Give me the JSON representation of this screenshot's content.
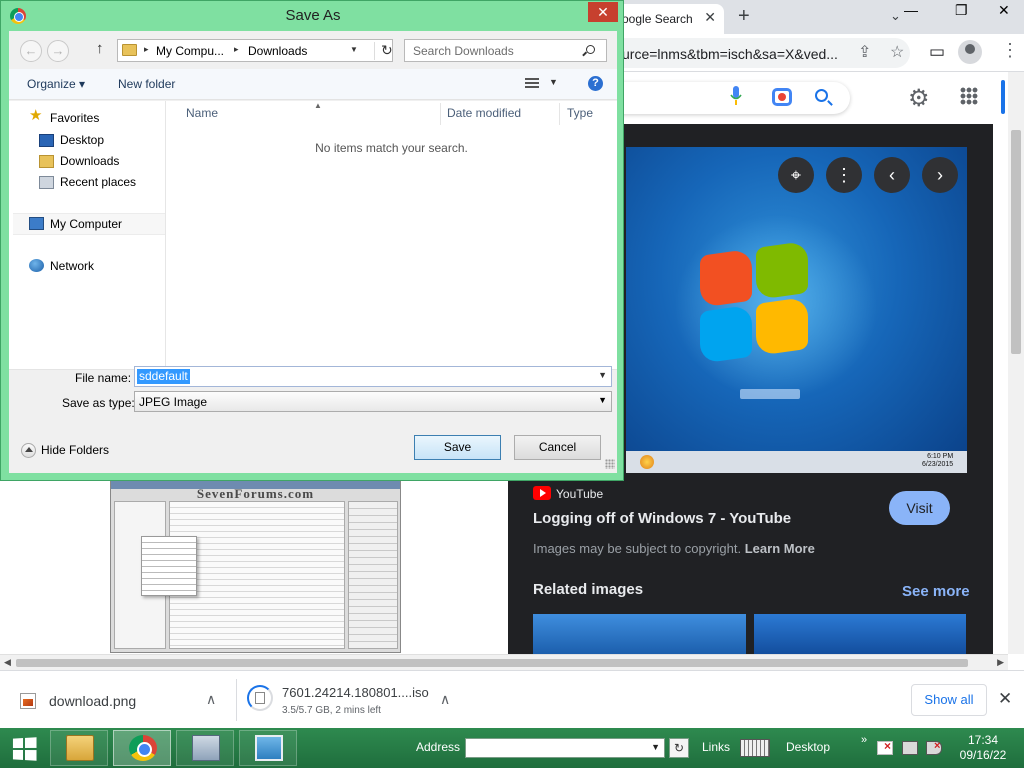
{
  "browser": {
    "tab": {
      "title": "oogle Search",
      "close": "✕"
    },
    "new_tab": "+",
    "tab_dropdown": "⌄",
    "window_controls": {
      "minimize": "—",
      "restore": "❐",
      "close": "✕"
    },
    "url": "urce=lnms&tbm=isch&sa=X&ved...",
    "toolbar_icons": [
      "share-icon",
      "star-icon",
      "sidepanel-icon",
      "profile-icon",
      "menu-icon"
    ],
    "toolbar_glyphs": {
      "share": "⇪",
      "star": "☆",
      "sidepanel": "▭",
      "menu": "⋮"
    },
    "header_icons": {
      "settings": "⚙"
    }
  },
  "search_results": {
    "thumbnail_title": "SevenForums.com"
  },
  "preview": {
    "controls": {
      "lens": "⌖",
      "more": "⋮",
      "prev": "‹",
      "next": "›"
    },
    "screenshot_clock": {
      "time": "6:10 PM",
      "date": "6/23/2015"
    },
    "source": "YouTube",
    "title": "Logging off of Windows 7 - YouTube",
    "visit_label": "Visit",
    "copyright_text": "Images may be subject to copyright.",
    "learn_more": "Learn More",
    "related_label": "Related images",
    "see_more": "See more"
  },
  "downloads": {
    "items": [
      {
        "name": "download.png",
        "status": ""
      },
      {
        "name": "7601.24214.180801....iso",
        "status": "3.5/5.7 GB, 2 mins left"
      }
    ],
    "chevron": "∧",
    "show_all": "Show all",
    "close": "✕"
  },
  "dialog": {
    "title": "Save As",
    "close": "✕",
    "nav": {
      "back": "←",
      "forward": "→",
      "up": "↑",
      "refresh": "↻"
    },
    "address_crumbs": [
      "My Compu...",
      "Downloads"
    ],
    "search_placeholder": "Search Downloads",
    "organize_label": "Organize ▾",
    "new_folder_label": "New folder",
    "help": "?",
    "nav_pane": {
      "favorites": "Favorites",
      "favorites_items": [
        "Desktop",
        "Downloads",
        "Recent places"
      ],
      "computer": "My Computer",
      "network": "Network"
    },
    "columns": [
      "Name",
      "Date modified",
      "Type"
    ],
    "empty_message": "No items match your search.",
    "file_name_label": "File name:",
    "file_name_value": "sddefault",
    "save_type_label": "Save as type:",
    "save_type_value": "JPEG Image",
    "hide_folders_label": "Hide Folders",
    "save_button": "Save",
    "cancel_button": "Cancel"
  },
  "taskbar": {
    "address_label": "Address",
    "links_label": "Links",
    "desktop_label": "Desktop",
    "overflow": "»",
    "refresh": "↻",
    "time": "17:34",
    "date": "09/16/22"
  }
}
